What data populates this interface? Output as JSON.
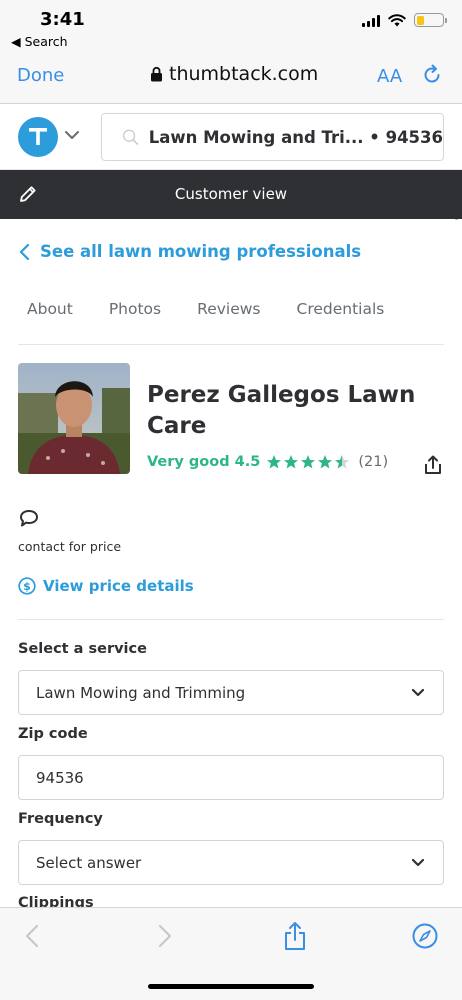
{
  "status_bar": {
    "time": "3:41",
    "back_label": "◀ Search"
  },
  "safari": {
    "done_label": "Done",
    "url": "thumbtack.com",
    "text_size_label": "AA"
  },
  "header": {
    "search_text": "Lawn Mowing and Tri... • 94536"
  },
  "customer_view": {
    "label": "Customer view"
  },
  "back_link": {
    "label": "See all lawn mowing professionals"
  },
  "tabs": [
    {
      "label": "About"
    },
    {
      "label": "Photos"
    },
    {
      "label": "Reviews"
    },
    {
      "label": "Credentials"
    }
  ],
  "pro": {
    "name": "Perez Gallegos Lawn Care",
    "rating_label": "Very good 4.5",
    "rating_value": 4.5,
    "rating_max": 5,
    "review_count": "(21)"
  },
  "pricing": {
    "contact_text": "contact for price",
    "details_link": "View price details"
  },
  "form": {
    "service": {
      "label": "Select a service",
      "value": "Lawn Mowing and Trimming"
    },
    "zip": {
      "label": "Zip code",
      "value": "94536"
    },
    "frequency": {
      "label": "Frequency",
      "value": "Select answer"
    },
    "clippings": {
      "label": "Clippings"
    }
  },
  "colors": {
    "brand_blue": "#2d9cdb",
    "rating_green": "#2db783",
    "dark_bar": "#2f3033",
    "safari_blue": "#3a8ee6"
  }
}
